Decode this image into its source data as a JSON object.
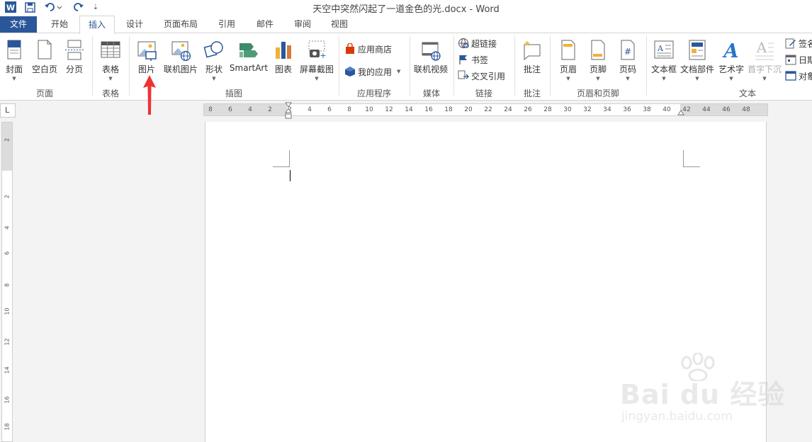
{
  "window": {
    "title": "天空中突然闪起了一道金色的光.docx - Word"
  },
  "quick_access": {
    "save_icon": "save-icon",
    "undo_icon": "undo-icon",
    "redo_icon": "redo-icon",
    "more": "⇣"
  },
  "tabs": [
    {
      "label": "文件"
    },
    {
      "label": "开始"
    },
    {
      "label": "插入"
    },
    {
      "label": "设计"
    },
    {
      "label": "页面布局"
    },
    {
      "label": "引用"
    },
    {
      "label": "邮件"
    },
    {
      "label": "审阅"
    },
    {
      "label": "视图"
    }
  ],
  "ribbon": {
    "pages_group": {
      "label": "页面",
      "cover": "封面",
      "blank": "空白页",
      "break": "分页"
    },
    "tables_group": {
      "label": "表格",
      "table": "表格"
    },
    "illustrations_group": {
      "label": "插图",
      "picture": "图片",
      "online_picture": "联机图片",
      "shapes": "形状",
      "smartart": "SmartArt",
      "chart": "图表",
      "screenshot": "屏幕截图"
    },
    "apps_group": {
      "label": "应用程序",
      "store": "应用商店",
      "my_apps": "我的应用"
    },
    "media_group": {
      "label": "媒体",
      "online_video": "联机视频"
    },
    "links_group": {
      "label": "链接",
      "hyperlink": "超链接",
      "bookmark": "书签",
      "cross_ref": "交叉引用"
    },
    "comments_group": {
      "label": "批注",
      "comment": "批注"
    },
    "header_footer_group": {
      "label": "页眉和页脚",
      "header": "页眉",
      "footer": "页脚",
      "page_number": "页码"
    },
    "text_group": {
      "label": "文本",
      "textbox": "文本框",
      "quick_parts": "文档部件",
      "wordart": "艺术字",
      "dropcap": "首字下沉",
      "signature": "签名",
      "date": "日期",
      "object": "对象"
    }
  },
  "ruler": {
    "corner": "L",
    "h_ticks": [
      "8",
      "6",
      "4",
      "2",
      "2",
      "4",
      "6",
      "8",
      "10",
      "12",
      "14",
      "16",
      "18",
      "20",
      "22",
      "24",
      "26",
      "28",
      "30",
      "32",
      "34",
      "36",
      "38",
      "40",
      "42",
      "44",
      "46",
      "48"
    ],
    "v_ticks": [
      "2",
      "2",
      "4",
      "6",
      "8",
      "10",
      "12",
      "14",
      "16",
      "18"
    ]
  },
  "watermark": {
    "brand": "Bai  du 经验",
    "url": "jingyan.baidu.com"
  },
  "colors": {
    "accent": "#2b579a",
    "arrow": "#ee3333"
  }
}
